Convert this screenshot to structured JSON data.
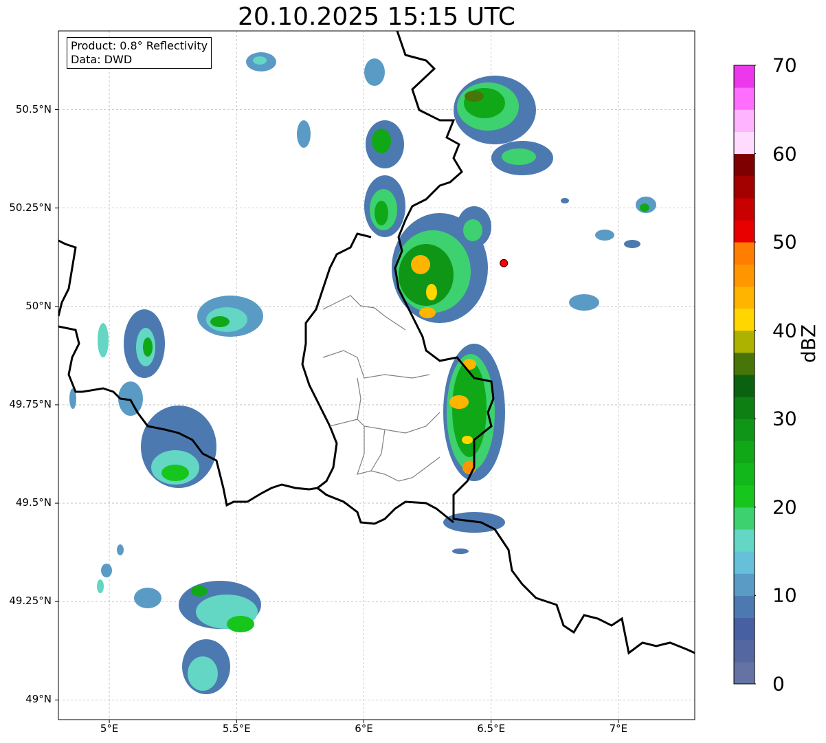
{
  "title": "20.10.2025 15:15 UTC",
  "info": {
    "product": "Product: 0.8° Reflectivity",
    "data": "Data: DWD"
  },
  "map": {
    "lon_range": [
      4.8,
      7.3
    ],
    "lat_range": [
      48.95,
      50.7
    ],
    "x_ticks": [
      {
        "value": 5.0,
        "label": "5°E"
      },
      {
        "value": 5.5,
        "label": "5.5°E"
      },
      {
        "value": 6.0,
        "label": "6°E"
      },
      {
        "value": 6.5,
        "label": "6.5°E"
      },
      {
        "value": 7.0,
        "label": "7°E"
      }
    ],
    "y_ticks": [
      {
        "value": 50.5,
        "label": "50.5°N"
      },
      {
        "value": 50.25,
        "label": "50.25°N"
      },
      {
        "value": 50.0,
        "label": "50°N"
      },
      {
        "value": 49.75,
        "label": "49.75°N"
      },
      {
        "value": 49.5,
        "label": "49.5°N"
      },
      {
        "value": 49.25,
        "label": "49.25°N"
      },
      {
        "value": 49.0,
        "label": "49°N"
      }
    ],
    "grid": true,
    "radar_site": {
      "lon": 6.55,
      "lat": 50.11,
      "color": "#ff0000"
    }
  },
  "colorbar": {
    "label": "dBZ",
    "min": 0,
    "max": 70,
    "ticks": [
      "0",
      "10",
      "20",
      "30",
      "40",
      "50",
      "60",
      "70"
    ],
    "colors": [
      "#6473a4",
      "#5467a0",
      "#4760a1",
      "#4c7ab0",
      "#5a9bc6",
      "#66c0da",
      "#63d6c4",
      "#3dd16f",
      "#16c61d",
      "#12b71b",
      "#11a818",
      "#0f9616",
      "#0d7f13",
      "#0a6210",
      "#477508",
      "#adb100",
      "#ffd600",
      "#ffb400",
      "#ff9600",
      "#ff7d00",
      "#e80000",
      "#c80000",
      "#a40000",
      "#7f0000",
      "#ffdcff",
      "#ffb4ff",
      "#ff6eff",
      "#ec37ec"
    ]
  }
}
